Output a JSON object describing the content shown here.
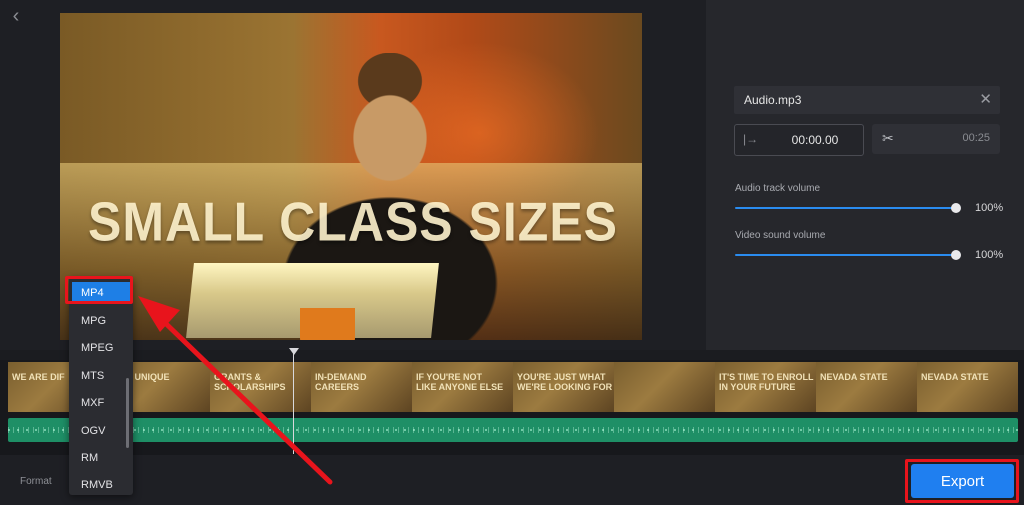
{
  "colors": {
    "accent": "#1f7ff0",
    "highlight": "#e8141c",
    "audio_track": "#1e8f66",
    "panel": "#26272c"
  },
  "header": {
    "back_icon": "chevron-left-icon"
  },
  "preview": {
    "overlay_text": "SMALL CLASS SIZES"
  },
  "audio": {
    "file_name": "Audio.mp3",
    "start_time": "00:00.00",
    "end_time": "00:25",
    "audio_track_volume_label": "Audio track volume",
    "audio_track_volume": "100%",
    "video_sound_volume_label": "Video sound volume",
    "video_sound_volume": "100%"
  },
  "timeline": {
    "clips": [
      "WE ARE DIF",
      "ARE UNIQUE",
      "GRANTS &\nSCHOLARSHIPS",
      "IN-DEMAND CAREERS",
      "IF YOU'RE NOT\nLIKE ANYONE ELSE",
      "YOU'RE JUST WHAT\nWE'RE LOOKING FOR",
      "",
      "IT'S TIME TO ENROLL\nIN YOUR FUTURE",
      "Nevada State",
      "Nevada State"
    ]
  },
  "format": {
    "label": "Format",
    "options": [
      "MP4",
      "MPG",
      "MPEG",
      "MTS",
      "MXF",
      "OGV",
      "RM",
      "RMVB"
    ],
    "selected": "MP4"
  },
  "export": {
    "label": "Export"
  }
}
